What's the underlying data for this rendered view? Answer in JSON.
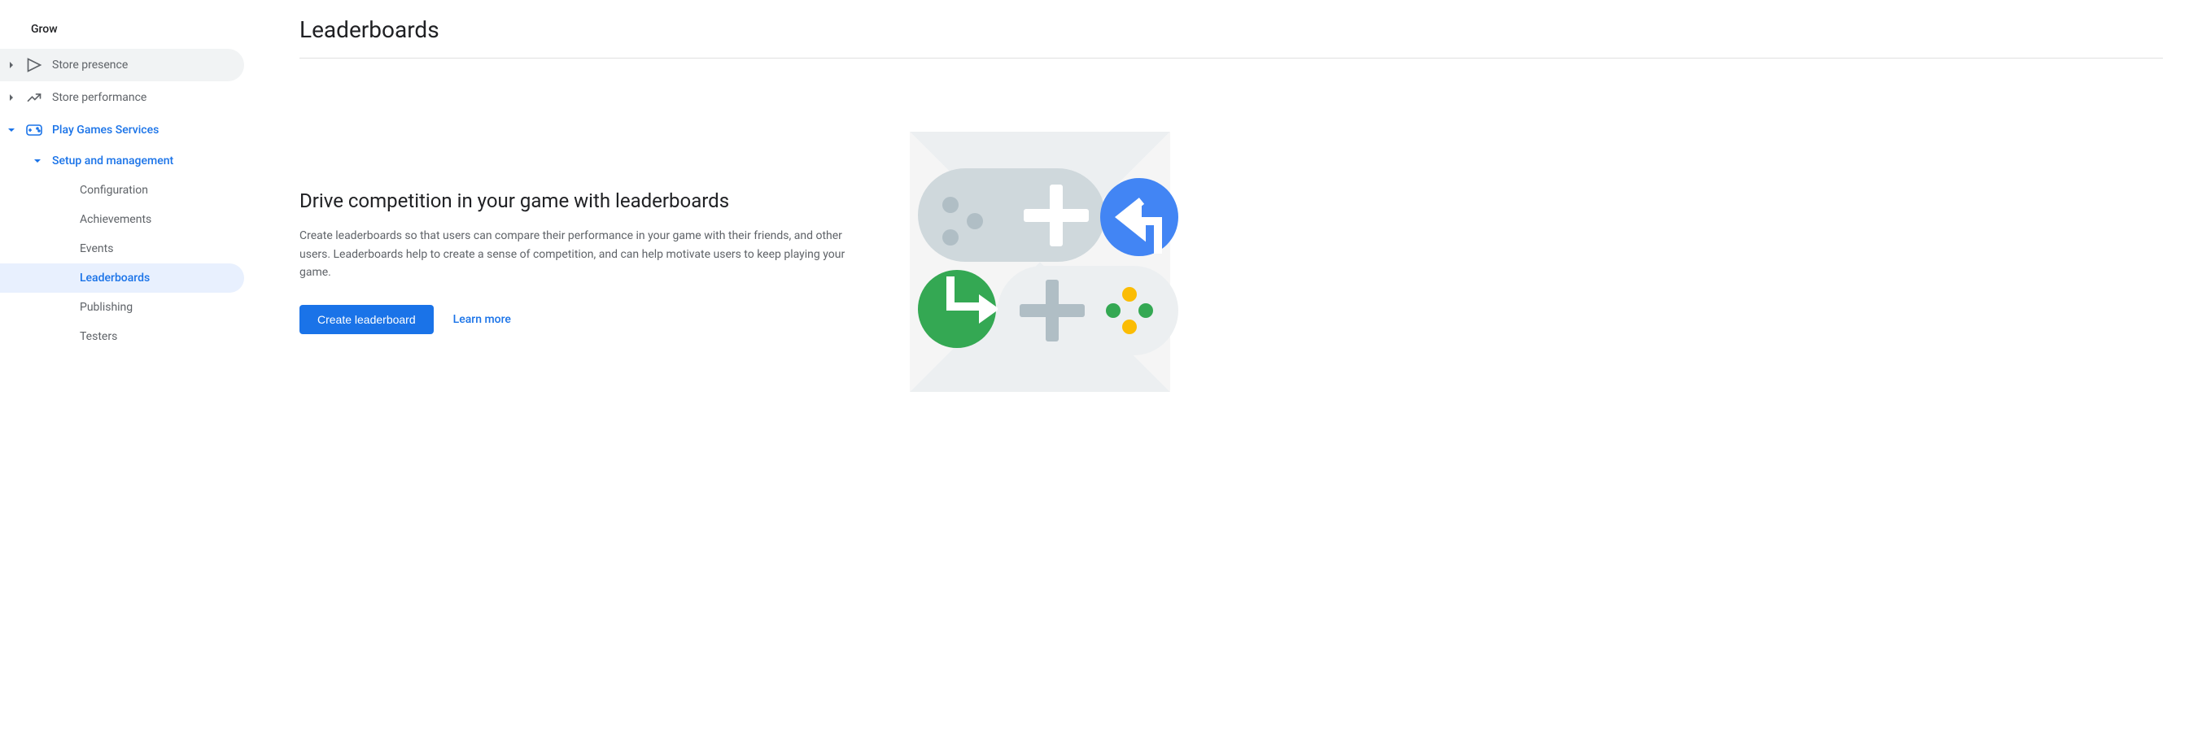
{
  "sidebar": {
    "heading": "Grow",
    "items": [
      {
        "label": "Store presence"
      },
      {
        "label": "Store performance"
      },
      {
        "label": "Play Games Services"
      },
      {
        "label": "Setup and management"
      },
      {
        "label": "Configuration"
      },
      {
        "label": "Achievements"
      },
      {
        "label": "Events"
      },
      {
        "label": "Leaderboards"
      },
      {
        "label": "Publishing"
      },
      {
        "label": "Testers"
      }
    ]
  },
  "page": {
    "title": "Leaderboards",
    "subtitle": "Drive competition in your game with leaderboards",
    "description": "Create leaderboards so that users can compare their performance in your game with their friends, and other users. Leaderboards help to create a sense of competition, and can help motivate users to keep playing your game.",
    "primary_button": "Create leaderboard",
    "learn_more": "Learn more"
  }
}
